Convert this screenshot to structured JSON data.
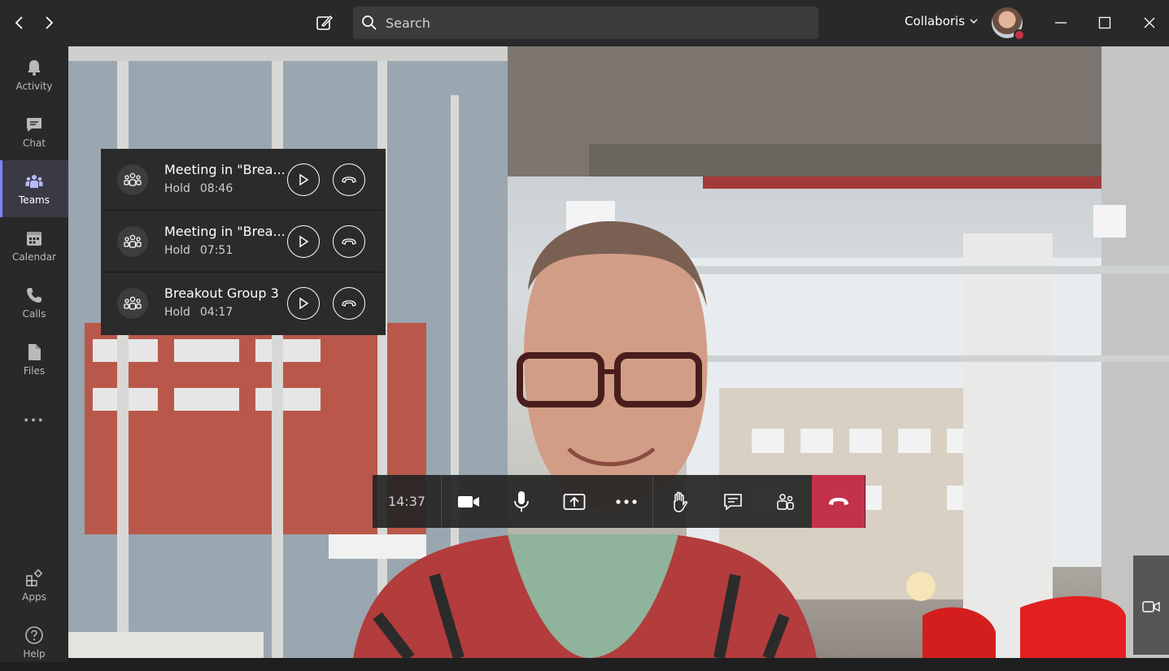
{
  "titlebar": {
    "search_placeholder": "Search",
    "org_name": "Collaboris",
    "icons": [
      "chevron-left-icon",
      "chevron-right-icon",
      "compose-icon",
      "search-icon",
      "chevron-down-icon",
      "minimize-icon",
      "maximize-icon",
      "close-icon"
    ]
  },
  "rail": {
    "items": [
      {
        "label": "Activity",
        "icon": "bell-icon"
      },
      {
        "label": "Chat",
        "icon": "chat-icon"
      },
      {
        "label": "Teams",
        "icon": "teams-icon",
        "active": true
      },
      {
        "label": "Calendar",
        "icon": "calendar-icon"
      },
      {
        "label": "Calls",
        "icon": "phone-icon"
      },
      {
        "label": "Files",
        "icon": "file-icon"
      }
    ],
    "more": "...",
    "apps_label": "Apps",
    "help_label": "Help"
  },
  "held_calls": [
    {
      "title": "Meeting in \"Brea...",
      "status": "Hold",
      "time": "08:46"
    },
    {
      "title": "Meeting in \"Brea...",
      "status": "Hold",
      "time": "07:51"
    },
    {
      "title": "Breakout Group 3",
      "status": "Hold",
      "time": "04:17"
    }
  ],
  "callbar": {
    "timer": "14:37",
    "buttons": [
      "camera-icon",
      "microphone-icon",
      "share-screen-icon",
      "more-icon",
      "raise-hand-icon",
      "chat-icon",
      "participants-icon",
      "hang-up-icon"
    ]
  },
  "colors": {
    "titlebar": "#292929",
    "hangup": "#c4314b",
    "accent": "#7f85f5"
  }
}
